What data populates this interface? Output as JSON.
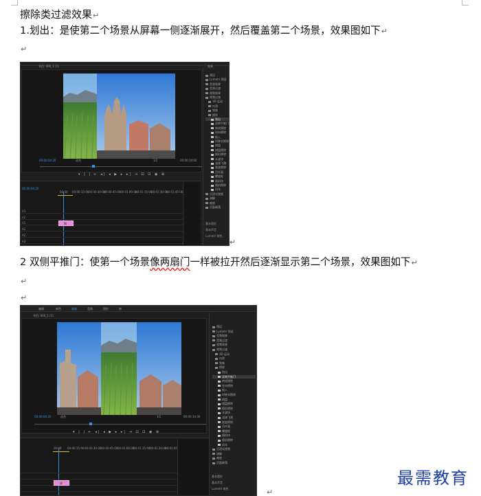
{
  "document": {
    "heading": "擦除类过滤效果",
    "p1": "1.划出：是使第二个场景从屏幕一侧逐渐展开，然后覆盖第二个场景，效果图如下",
    "p2_a": "2 双侧平推门：使第一个场景",
    "p2_b": "像两扇门",
    "p2_c": "一样被拉开然后逐渐显示第二个场景，效果图如下",
    "para_mark": "↵"
  },
  "screenshot1": {
    "menu": [
      "",
      "",
      "",
      "",
      "",
      "",
      ""
    ],
    "tab_title": "节目: 000_1 (1)",
    "panel_title": "效果",
    "timecode_left": "00:00:04:20",
    "fit": "适合",
    "scale": "1/2",
    "timecode_right": "00:00:14:00",
    "timeline_timecode": "00:00:04:20",
    "ruler": [
      "00:00",
      "00:00:15:00",
      "00:00:30:00",
      "00:00:45:00",
      "00:01:00:00",
      "00:01:15:00",
      "00:01:30:00",
      "00:01:45:00"
    ],
    "tracks": [
      "V3",
      "V2",
      "V1",
      "A1",
      "A2",
      "A3"
    ],
    "clip_label": "划",
    "effects": [
      {
        "label": "预设",
        "type": "folder"
      },
      {
        "label": "Lumetri 预设",
        "type": "folder"
      },
      {
        "label": "音频效果",
        "type": "folder"
      },
      {
        "label": "音频过渡",
        "type": "folder"
      },
      {
        "label": "视频效果",
        "type": "folder"
      },
      {
        "label": "视频过渡",
        "type": "folder"
      },
      {
        "label": "3D 运动",
        "type": "folder"
      },
      {
        "label": "内滑",
        "type": "folder"
      },
      {
        "label": "划像",
        "type": "folder"
      },
      {
        "label": "擦除",
        "type": "folder"
      },
      {
        "label": "划出",
        "type": "item",
        "selected": true
      },
      {
        "label": "双侧平推门",
        "type": "item"
      },
      {
        "label": "带状擦除",
        "type": "item"
      },
      {
        "label": "径向擦除",
        "type": "item"
      },
      {
        "label": "插入",
        "type": "item"
      },
      {
        "label": "时钟式擦除",
        "type": "item"
      },
      {
        "label": "棋盘",
        "type": "item"
      },
      {
        "label": "棋盘擦除",
        "type": "item"
      },
      {
        "label": "楔形擦除",
        "type": "item"
      },
      {
        "label": "水波块",
        "type": "item"
      },
      {
        "label": "油漆飞溅",
        "type": "item"
      },
      {
        "label": "渐变擦除",
        "type": "item"
      },
      {
        "label": "百叶窗",
        "type": "item"
      },
      {
        "label": "螺旋框",
        "type": "item"
      },
      {
        "label": "随机块",
        "type": "item"
      },
      {
        "label": "随机擦除",
        "type": "item"
      },
      {
        "label": "风车",
        "type": "item"
      },
      {
        "label": "沉浸式视频",
        "type": "folder"
      },
      {
        "label": "溶解",
        "type": "folder"
      },
      {
        "label": "缩放",
        "type": "folder"
      },
      {
        "label": "页面剥落",
        "type": "folder"
      }
    ],
    "bottom_items": [
      "基本图形",
      "基本声音",
      "Lumetri 颜色"
    ]
  },
  "screenshot2": {
    "menu": [
      "编辑",
      "颜色",
      "效果",
      "音频",
      "图形",
      "库"
    ],
    "tab_title": "节目: 000_1 (1)",
    "panel_title": "效果",
    "timecode_left": "00:00:04:20",
    "fit": "适合",
    "scale": "1/2",
    "timecode_right": "00:00:14:00",
    "ruler": [
      "00:00",
      "00:00:15:00",
      "00:00:30:00",
      "00:00:45:00",
      "00:01:00:00",
      "00:01:15:00",
      "00:01:30:00",
      "00:01:45:00"
    ],
    "clip_label": "双",
    "effects": [
      {
        "label": "预设",
        "type": "folder"
      },
      {
        "label": "Lumetri 预设",
        "type": "folder"
      },
      {
        "label": "音频效果",
        "type": "folder"
      },
      {
        "label": "音频过渡",
        "type": "folder"
      },
      {
        "label": "视频效果",
        "type": "folder"
      },
      {
        "label": "视频过渡",
        "type": "folder"
      },
      {
        "label": "3D 运动",
        "type": "folder"
      },
      {
        "label": "内滑",
        "type": "folder"
      },
      {
        "label": "划像",
        "type": "folder"
      },
      {
        "label": "擦除",
        "type": "folder"
      },
      {
        "label": "划出",
        "type": "item"
      },
      {
        "label": "双侧平推门",
        "type": "item",
        "selected": true
      },
      {
        "label": "带状擦除",
        "type": "item"
      },
      {
        "label": "径向擦除",
        "type": "item"
      },
      {
        "label": "插入",
        "type": "item"
      },
      {
        "label": "时钟式擦除",
        "type": "item"
      },
      {
        "label": "棋盘",
        "type": "item"
      },
      {
        "label": "棋盘擦除",
        "type": "item"
      },
      {
        "label": "楔形擦除",
        "type": "item"
      },
      {
        "label": "水波块",
        "type": "item"
      },
      {
        "label": "油漆飞溅",
        "type": "item"
      },
      {
        "label": "渐变擦除",
        "type": "item"
      },
      {
        "label": "百叶窗",
        "type": "item"
      },
      {
        "label": "螺旋框",
        "type": "item"
      },
      {
        "label": "随机块",
        "type": "item"
      },
      {
        "label": "随机擦除",
        "type": "item"
      },
      {
        "label": "风车",
        "type": "item"
      },
      {
        "label": "沉浸式视频",
        "type": "folder"
      },
      {
        "label": "溶解",
        "type": "folder"
      },
      {
        "label": "缩放",
        "type": "folder"
      },
      {
        "label": "页面剥落",
        "type": "folder"
      }
    ],
    "bottom_items": [
      "基本图形",
      "基本声音",
      "Lumetri 颜色"
    ]
  },
  "watermark": "最需教育",
  "colors": {
    "accent": "#3f8fe3",
    "clip": "#e88ad7",
    "panel": "#1f1f1f",
    "logo": "#1f3fa8"
  }
}
